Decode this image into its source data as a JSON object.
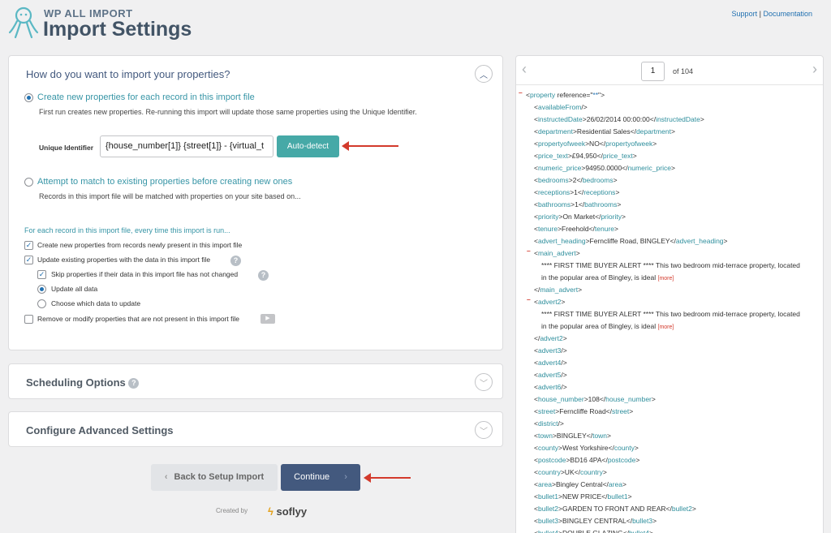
{
  "header": {
    "brand": "WP ALL IMPORT",
    "title": "Import Settings",
    "support": "Support",
    "separator": "|",
    "documentation": "Documentation"
  },
  "main": {
    "question": "How do you want to import your properties?",
    "option_create": {
      "label": "Create new properties for each record in this import file",
      "description": "First run creates new properties. Re-running this import will update those same properties using the Unique Identifier.",
      "selected": true
    },
    "unique_identifier": {
      "label": "Unique Identifier",
      "value": "{house_number[1]} {street[1]} - {virtual_t",
      "button": "Auto-detect"
    },
    "option_match": {
      "label": "Attempt to match to existing properties before creating new ones",
      "description": "Records in this import file will be matched with properties on your site based on...",
      "selected": false
    },
    "each_record_heading": "For each record in this import file, every time this import is run...",
    "checks": [
      {
        "label": "Create new properties from records newly present in this import file",
        "checked": true
      },
      {
        "label": "Update existing properties with the data in this import file",
        "checked": true
      },
      {
        "label": "Skip properties if their data in this import file has not changed",
        "checked": true
      }
    ],
    "radios": [
      {
        "label": "Update all data",
        "selected": true
      },
      {
        "label": "Choose which data to update",
        "selected": false
      }
    ],
    "remove_check": {
      "label": "Remove or modify properties that are not present in this import file",
      "checked": false
    }
  },
  "scheduling": {
    "title": "Scheduling Options"
  },
  "advanced": {
    "title": "Configure Advanced Settings"
  },
  "footer": {
    "back": "Back to Setup Import",
    "continue": "Continue",
    "created_by": "Created by",
    "company": "soflyy"
  },
  "xml": {
    "page": "1",
    "of": "of 104",
    "lines": [
      {
        "minus": true,
        "indent": 0,
        "parts": [
          [
            "t",
            "<"
          ],
          [
            "g",
            "property"
          ],
          [
            "t",
            " reference=\""
          ],
          [
            "b",
            "**"
          ],
          [
            "t",
            "\">"
          ]
        ]
      },
      {
        "indent": 1,
        "parts": [
          [
            "t",
            "<"
          ],
          [
            "g",
            "availableFrom"
          ],
          [
            "t",
            "/>"
          ]
        ]
      },
      {
        "indent": 1,
        "parts": [
          [
            "t",
            "<"
          ],
          [
            "g",
            "instructedDate"
          ],
          [
            "t",
            ">26/02/2014 00:00:00</"
          ],
          [
            "g",
            "instructedDate"
          ],
          [
            "t",
            ">"
          ]
        ]
      },
      {
        "indent": 1,
        "parts": [
          [
            "t",
            "<"
          ],
          [
            "g",
            "department"
          ],
          [
            "t",
            ">Residential Sales</"
          ],
          [
            "g",
            "department"
          ],
          [
            "t",
            ">"
          ]
        ]
      },
      {
        "indent": 1,
        "parts": [
          [
            "t",
            "<"
          ],
          [
            "g",
            "propertyofweek"
          ],
          [
            "t",
            ">NO</"
          ],
          [
            "g",
            "propertyofweek"
          ],
          [
            "t",
            ">"
          ]
        ]
      },
      {
        "indent": 1,
        "parts": [
          [
            "t",
            "<"
          ],
          [
            "g",
            "price_text"
          ],
          [
            "t",
            ">£94,950</"
          ],
          [
            "g",
            "price_text"
          ],
          [
            "t",
            ">"
          ]
        ]
      },
      {
        "indent": 1,
        "parts": [
          [
            "t",
            "<"
          ],
          [
            "g",
            "numeric_price"
          ],
          [
            "t",
            ">94950.0000</"
          ],
          [
            "g",
            "numeric_price"
          ],
          [
            "t",
            ">"
          ]
        ]
      },
      {
        "indent": 1,
        "parts": [
          [
            "t",
            "<"
          ],
          [
            "g",
            "bedrooms"
          ],
          [
            "t",
            ">2</"
          ],
          [
            "g",
            "bedrooms"
          ],
          [
            "t",
            ">"
          ]
        ]
      },
      {
        "indent": 1,
        "parts": [
          [
            "t",
            "<"
          ],
          [
            "g",
            "receptions"
          ],
          [
            "t",
            ">1</"
          ],
          [
            "g",
            "receptions"
          ],
          [
            "t",
            ">"
          ]
        ]
      },
      {
        "indent": 1,
        "parts": [
          [
            "t",
            "<"
          ],
          [
            "g",
            "bathrooms"
          ],
          [
            "t",
            ">1</"
          ],
          [
            "g",
            "bathrooms"
          ],
          [
            "t",
            ">"
          ]
        ]
      },
      {
        "indent": 1,
        "parts": [
          [
            "t",
            "<"
          ],
          [
            "g",
            "priority"
          ],
          [
            "t",
            ">On Market</"
          ],
          [
            "g",
            "priority"
          ],
          [
            "t",
            ">"
          ]
        ]
      },
      {
        "indent": 1,
        "parts": [
          [
            "t",
            "<"
          ],
          [
            "g",
            "tenure"
          ],
          [
            "t",
            ">Freehold</"
          ],
          [
            "g",
            "tenure"
          ],
          [
            "t",
            ">"
          ]
        ]
      },
      {
        "indent": 1,
        "parts": [
          [
            "t",
            "<"
          ],
          [
            "g",
            "advert_heading"
          ],
          [
            "t",
            ">Ferncliffe Road, BINGLEY</"
          ],
          [
            "g",
            "advert_heading"
          ],
          [
            "t",
            ">"
          ]
        ]
      },
      {
        "minus": true,
        "indent": 1,
        "parts": [
          [
            "t",
            "<"
          ],
          [
            "g",
            "main_advert"
          ],
          [
            "t",
            ">"
          ]
        ]
      },
      {
        "indent": 2,
        "parts": [
          [
            "t",
            "**** FIRST TIME BUYER ALERT **** This two bedroom mid-terrace property, located"
          ]
        ]
      },
      {
        "indent": 2,
        "parts": [
          [
            "t",
            "in the popular area of Bingley, is ideal "
          ],
          [
            "m",
            "[more]"
          ]
        ]
      },
      {
        "indent": 1,
        "parts": [
          [
            "t",
            "</"
          ],
          [
            "g",
            "main_advert"
          ],
          [
            "t",
            ">"
          ]
        ]
      },
      {
        "minus": true,
        "indent": 1,
        "parts": [
          [
            "t",
            "<"
          ],
          [
            "g",
            "advert2"
          ],
          [
            "t",
            ">"
          ]
        ]
      },
      {
        "indent": 2,
        "parts": [
          [
            "t",
            "**** FIRST TIME BUYER ALERT **** This two bedroom mid-terrace property, located"
          ]
        ]
      },
      {
        "indent": 2,
        "parts": [
          [
            "t",
            "in the popular area of Bingley, is ideal "
          ],
          [
            "m",
            "[more]"
          ]
        ]
      },
      {
        "indent": 1,
        "parts": [
          [
            "t",
            "</"
          ],
          [
            "g",
            "advert2"
          ],
          [
            "t",
            ">"
          ]
        ]
      },
      {
        "indent": 1,
        "parts": [
          [
            "t",
            "<"
          ],
          [
            "g",
            "advert3"
          ],
          [
            "t",
            "/>"
          ]
        ]
      },
      {
        "indent": 1,
        "parts": [
          [
            "t",
            "<"
          ],
          [
            "g",
            "advert4"
          ],
          [
            "t",
            "/>"
          ]
        ]
      },
      {
        "indent": 1,
        "parts": [
          [
            "t",
            "<"
          ],
          [
            "g",
            "advert5"
          ],
          [
            "t",
            "/>"
          ]
        ]
      },
      {
        "indent": 1,
        "parts": [
          [
            "t",
            "<"
          ],
          [
            "g",
            "advert6"
          ],
          [
            "t",
            "/>"
          ]
        ]
      },
      {
        "indent": 1,
        "parts": [
          [
            "t",
            "<"
          ],
          [
            "g",
            "house_number"
          ],
          [
            "t",
            ">108</"
          ],
          [
            "g",
            "house_number"
          ],
          [
            "t",
            ">"
          ]
        ]
      },
      {
        "indent": 1,
        "parts": [
          [
            "t",
            "<"
          ],
          [
            "g",
            "street"
          ],
          [
            "t",
            ">Ferncliffe Road</"
          ],
          [
            "g",
            "street"
          ],
          [
            "t",
            ">"
          ]
        ]
      },
      {
        "indent": 1,
        "parts": [
          [
            "t",
            "<"
          ],
          [
            "g",
            "district"
          ],
          [
            "t",
            "/>"
          ]
        ]
      },
      {
        "indent": 1,
        "parts": [
          [
            "t",
            "<"
          ],
          [
            "g",
            "town"
          ],
          [
            "t",
            ">BINGLEY</"
          ],
          [
            "g",
            "town"
          ],
          [
            "t",
            ">"
          ]
        ]
      },
      {
        "indent": 1,
        "parts": [
          [
            "t",
            "<"
          ],
          [
            "g",
            "county"
          ],
          [
            "t",
            ">West Yorkshire</"
          ],
          [
            "g",
            "county"
          ],
          [
            "t",
            ">"
          ]
        ]
      },
      {
        "indent": 1,
        "parts": [
          [
            "t",
            "<"
          ],
          [
            "g",
            "postcode"
          ],
          [
            "t",
            ">BD16 4PA</"
          ],
          [
            "g",
            "postcode"
          ],
          [
            "t",
            ">"
          ]
        ]
      },
      {
        "indent": 1,
        "parts": [
          [
            "t",
            "<"
          ],
          [
            "g",
            "country"
          ],
          [
            "t",
            ">UK</"
          ],
          [
            "g",
            "country"
          ],
          [
            "t",
            ">"
          ]
        ]
      },
      {
        "indent": 1,
        "parts": [
          [
            "t",
            "<"
          ],
          [
            "g",
            "area"
          ],
          [
            "t",
            ">Bingley Central</"
          ],
          [
            "g",
            "area"
          ],
          [
            "t",
            ">"
          ]
        ]
      },
      {
        "indent": 1,
        "parts": [
          [
            "t",
            "<"
          ],
          [
            "g",
            "bullet1"
          ],
          [
            "t",
            ">NEW PRICE</"
          ],
          [
            "g",
            "bullet1"
          ],
          [
            "t",
            ">"
          ]
        ]
      },
      {
        "indent": 1,
        "parts": [
          [
            "t",
            "<"
          ],
          [
            "g",
            "bullet2"
          ],
          [
            "t",
            ">GARDEN TO FRONT AND REAR</"
          ],
          [
            "g",
            "bullet2"
          ],
          [
            "t",
            ">"
          ]
        ]
      },
      {
        "indent": 1,
        "parts": [
          [
            "t",
            "<"
          ],
          [
            "g",
            "bullet3"
          ],
          [
            "t",
            ">BINGLEY CENTRAL</"
          ],
          [
            "g",
            "bullet3"
          ],
          [
            "t",
            ">"
          ]
        ]
      },
      {
        "indent": 1,
        "parts": [
          [
            "t",
            "<"
          ],
          [
            "g",
            "bullet4"
          ],
          [
            "t",
            ">DOUBLE GLAZING</"
          ],
          [
            "g",
            "bullet4"
          ],
          [
            "t",
            ">"
          ]
        ]
      }
    ]
  },
  "colors": {
    "accent": "#43597e",
    "teal": "#46a9a7",
    "tag": "#2f8f9d",
    "arrow": "#d33a2c"
  }
}
